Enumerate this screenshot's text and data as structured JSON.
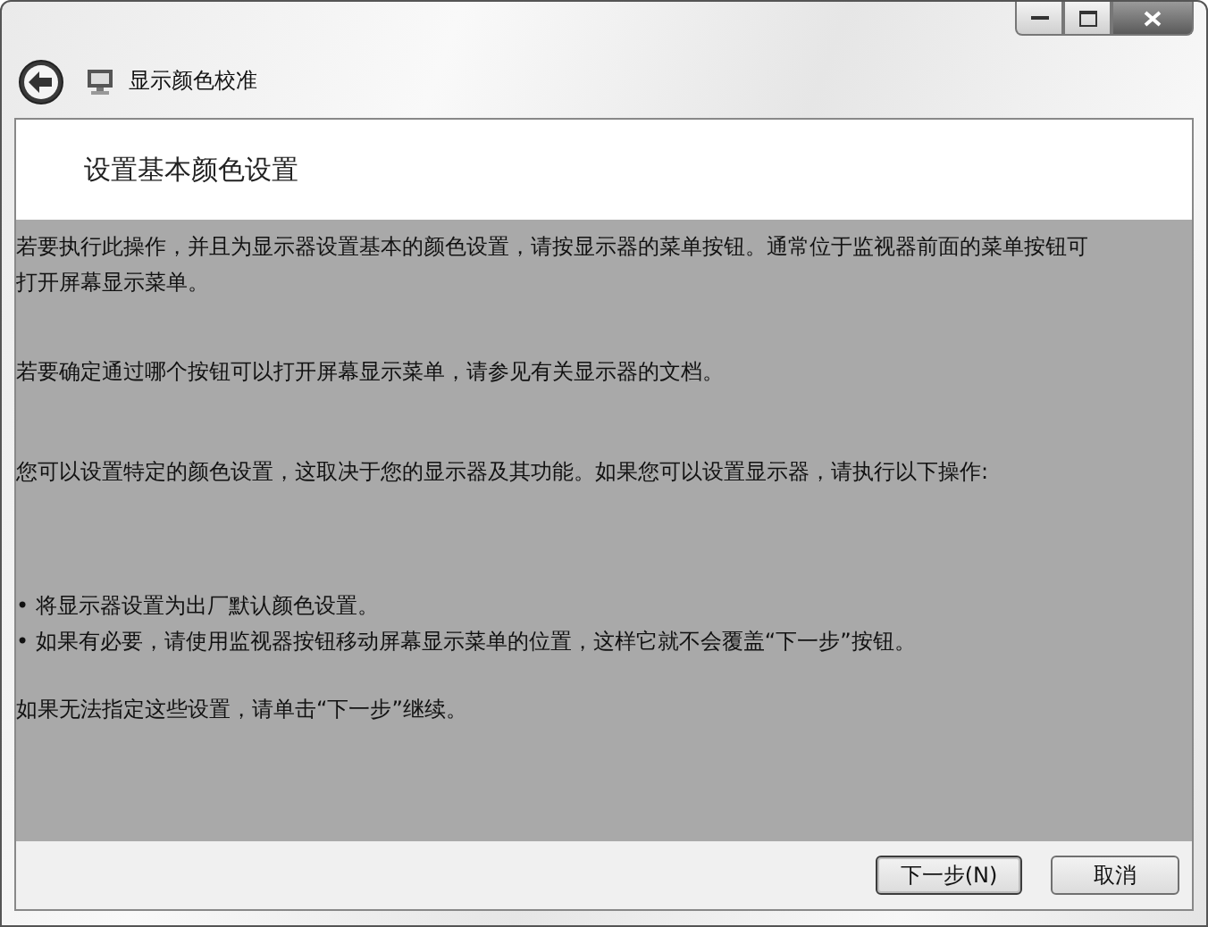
{
  "window": {
    "title": "显示颜色校准"
  },
  "heading": "设置基本颜色设置",
  "paragraphs": [
    "若要执行此操作，并且为显示器设置基本的颜色设置，请按显示器的菜单按钮。通常位于监视器前面的菜单按钮可打开屏幕显示菜单。",
    "若要确定通过哪个按钮可以打开屏幕显示菜单，请参见有关显示器的文档。",
    "您可以设置特定的颜色设置，这取决于您的显示器及其功能。如果您可以设置显示器，请执行以下操作:",
    "• 将显示器设置为出厂默认颜色设置。",
    "• 如果有必要，请使用监视器按钮移动屏幕显示菜单的位置，这样它就不会覆盖“下一步”按钮。",
    "如果无法指定这些设置，请单击“下一步”继续。"
  ],
  "buttons": [
    {
      "label": "下一步(N)",
      "default": true
    },
    {
      "label": "取消",
      "default": false
    }
  ]
}
